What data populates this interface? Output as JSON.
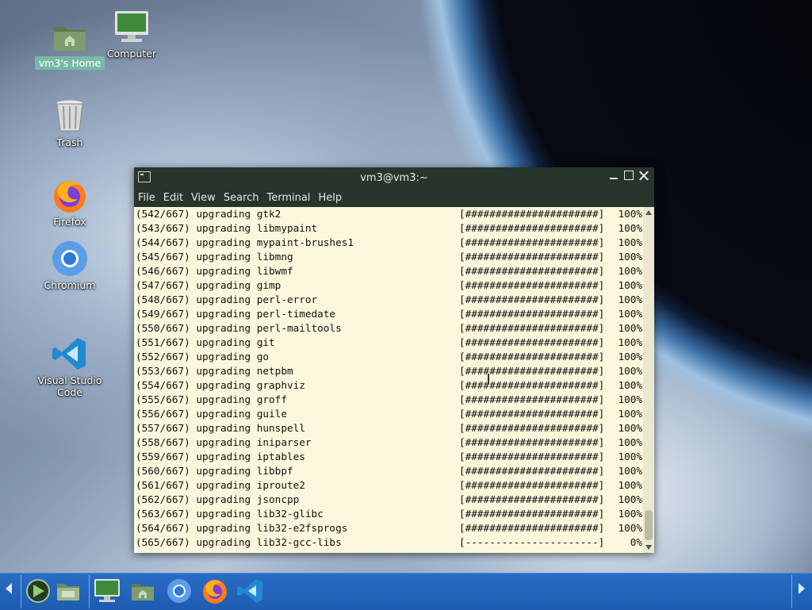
{
  "desktop": {
    "icons": [
      {
        "label": "vm3's Home",
        "icon": "home-folder-icon",
        "selected": true
      },
      {
        "label": "Computer",
        "icon": "computer-icon"
      },
      {
        "label": "Trash",
        "icon": "trash-icon"
      },
      {
        "label": "Firefox",
        "icon": "firefox-icon"
      },
      {
        "label": "Chromium",
        "icon": "chromium-icon"
      },
      {
        "label": "Visual Studio Code",
        "icon": "vscode-icon"
      }
    ]
  },
  "terminal": {
    "title": "vm3@vm3:~",
    "menu": [
      "File",
      "Edit",
      "View",
      "Search",
      "Terminal",
      "Help"
    ],
    "lines": [
      {
        "left": "(542/667) upgrading gtk2",
        "bar": "[######################]",
        "pct": "100%"
      },
      {
        "left": "(543/667) upgrading libmypaint",
        "bar": "[######################]",
        "pct": "100%"
      },
      {
        "left": "(544/667) upgrading mypaint-brushes1",
        "bar": "[######################]",
        "pct": "100%"
      },
      {
        "left": "(545/667) upgrading libmng",
        "bar": "[######################]",
        "pct": "100%"
      },
      {
        "left": "(546/667) upgrading libwmf",
        "bar": "[######################]",
        "pct": "100%"
      },
      {
        "left": "(547/667) upgrading gimp",
        "bar": "[######################]",
        "pct": "100%"
      },
      {
        "left": "(548/667) upgrading perl-error",
        "bar": "[######################]",
        "pct": "100%"
      },
      {
        "left": "(549/667) upgrading perl-timedate",
        "bar": "[######################]",
        "pct": "100%"
      },
      {
        "left": "(550/667) upgrading perl-mailtools",
        "bar": "[######################]",
        "pct": "100%"
      },
      {
        "left": "(551/667) upgrading git",
        "bar": "[######################]",
        "pct": "100%"
      },
      {
        "left": "(552/667) upgrading go",
        "bar": "[######################]",
        "pct": "100%"
      },
      {
        "left": "(553/667) upgrading netpbm",
        "bar": "[######################]",
        "pct": "100%"
      },
      {
        "left": "(554/667) upgrading graphviz",
        "bar": "[######################]",
        "pct": "100%"
      },
      {
        "left": "(555/667) upgrading groff",
        "bar": "[######################]",
        "pct": "100%"
      },
      {
        "left": "(556/667) upgrading guile",
        "bar": "[######################]",
        "pct": "100%"
      },
      {
        "left": "(557/667) upgrading hunspell",
        "bar": "[######################]",
        "pct": "100%"
      },
      {
        "left": "(558/667) upgrading iniparser",
        "bar": "[######################]",
        "pct": "100%"
      },
      {
        "left": "(559/667) upgrading iptables",
        "bar": "[######################]",
        "pct": "100%"
      },
      {
        "left": "(560/667) upgrading libbpf",
        "bar": "[######################]",
        "pct": "100%"
      },
      {
        "left": "(561/667) upgrading iproute2",
        "bar": "[######################]",
        "pct": "100%"
      },
      {
        "left": "(562/667) upgrading jsoncpp",
        "bar": "[######################]",
        "pct": "100%"
      },
      {
        "left": "(563/667) upgrading lib32-glibc",
        "bar": "[######################]",
        "pct": "100%"
      },
      {
        "left": "(564/667) upgrading lib32-e2fsprogs",
        "bar": "[######################]",
        "pct": "100%"
      },
      {
        "left": "(565/667) upgrading lib32-gcc-libs",
        "bar": "[----------------------]",
        "pct": "0%"
      }
    ]
  },
  "taskbar": {
    "items": [
      "menu-icon",
      "show-desktop-icon",
      "computer-icon",
      "home-folder-icon",
      "chromium-icon",
      "firefox-icon",
      "vscode-icon"
    ]
  },
  "colors": {
    "terminal_bg": "#fbf7dc",
    "taskbar": "#2366bd",
    "selection": "#78c8aa"
  }
}
